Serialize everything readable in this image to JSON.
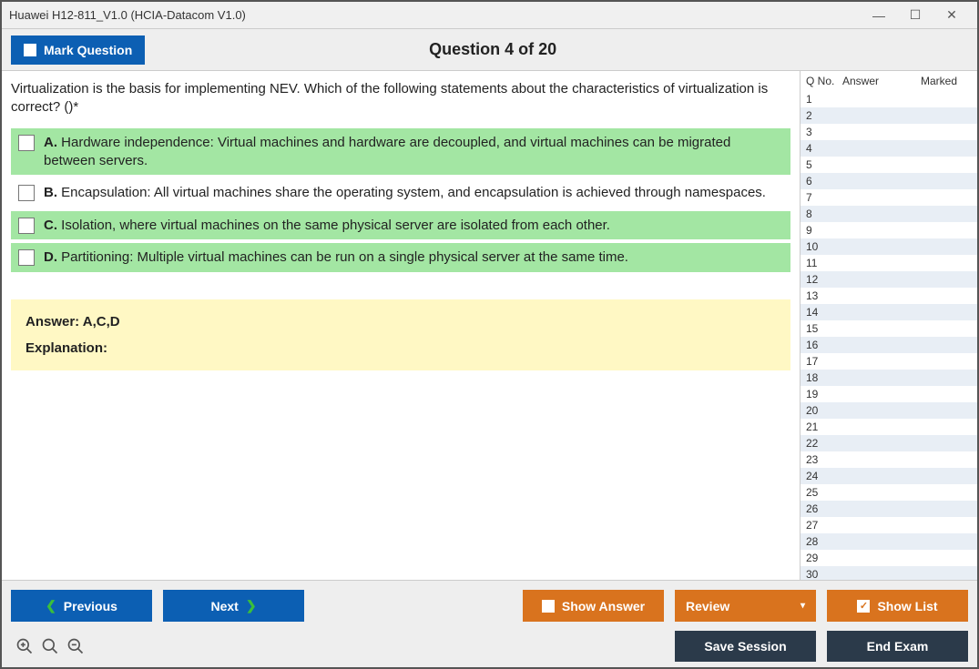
{
  "window": {
    "title": "Huawei H12-811_V1.0 (HCIA-Datacom V1.0)"
  },
  "header": {
    "mark_label": "Mark Question",
    "question_title": "Question 4 of 20"
  },
  "question": {
    "text": "Virtualization is the basis for implementing NEV. Which of the following statements about the characteristics of virtualization is correct? ()*",
    "options": {
      "a": {
        "letter": "A.",
        "text": "Hardware independence: Virtual machines and hardware are decoupled, and virtual machines can be migrated between servers."
      },
      "b": {
        "letter": "B.",
        "text": "Encapsulation: All virtual machines share the operating system, and encapsulation is achieved through namespaces."
      },
      "c": {
        "letter": "C.",
        "text": "Isolation, where virtual machines on the same physical server are isolated from each other."
      },
      "d": {
        "letter": "D.",
        "text": "Partitioning: Multiple virtual machines can be run on a single physical server at the same time."
      }
    }
  },
  "answer": {
    "label": "Answer: A,C,D",
    "explanation_label": "Explanation:"
  },
  "sidebar": {
    "header": {
      "qno": "Q No.",
      "answer": "Answer",
      "marked": "Marked"
    },
    "rows": [
      "1",
      "2",
      "3",
      "4",
      "5",
      "6",
      "7",
      "8",
      "9",
      "10",
      "11",
      "12",
      "13",
      "14",
      "15",
      "16",
      "17",
      "18",
      "19",
      "20",
      "21",
      "22",
      "23",
      "24",
      "25",
      "26",
      "27",
      "28",
      "29",
      "30"
    ]
  },
  "footer": {
    "previous": "Previous",
    "next": "Next",
    "show_answer": "Show Answer",
    "review": "Review",
    "show_list": "Show List",
    "save_session": "Save Session",
    "end_exam": "End Exam"
  }
}
